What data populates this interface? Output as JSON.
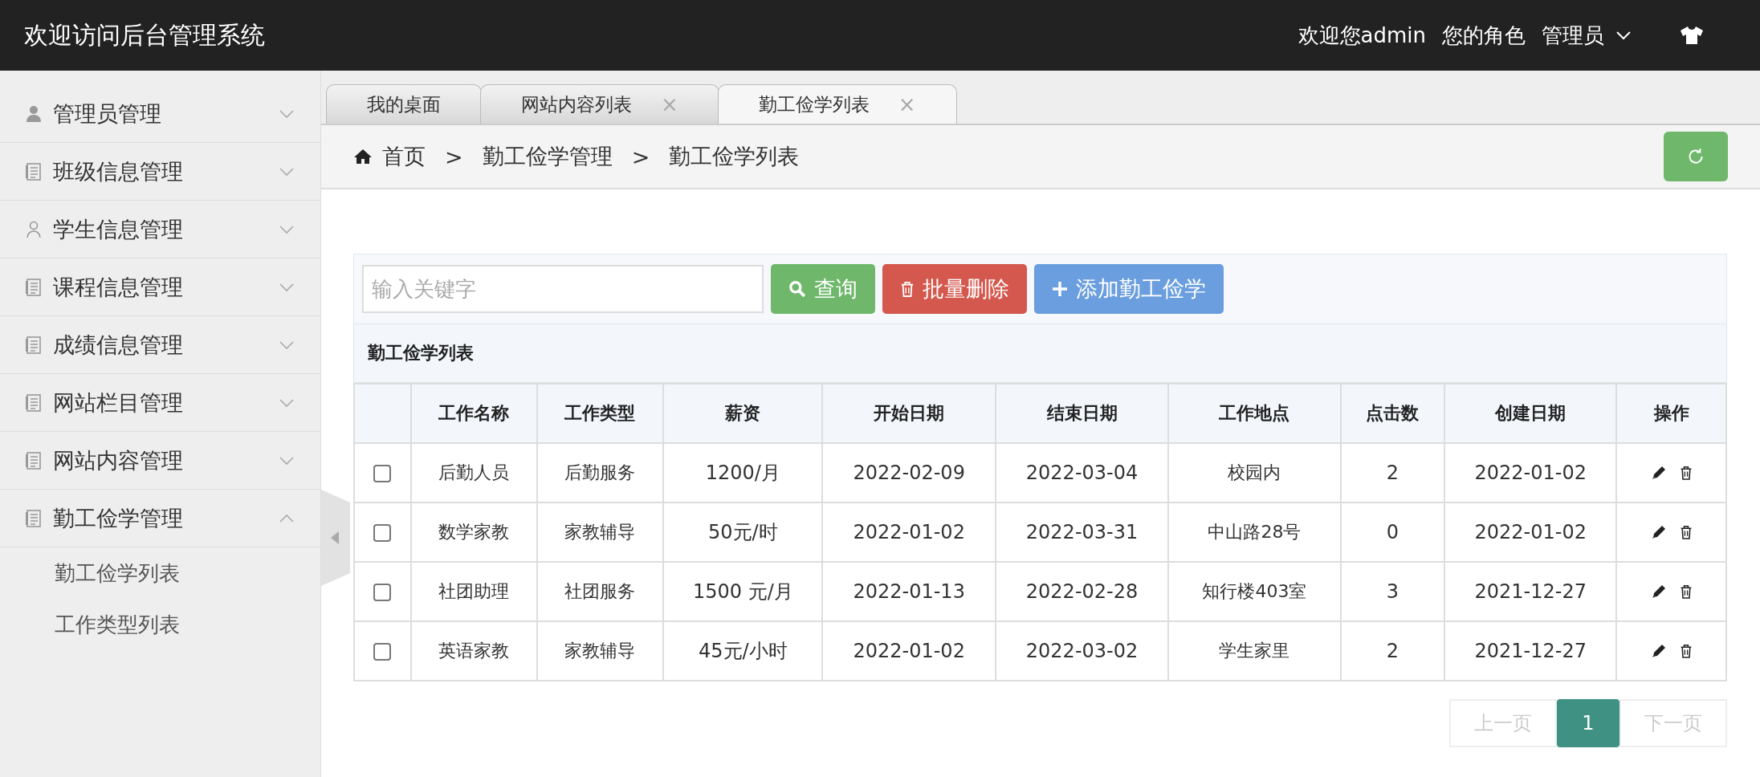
{
  "header": {
    "title": "欢迎访问后台管理系统",
    "welcome": "欢迎您admin",
    "role_label": "您的角色",
    "role": "管理员"
  },
  "sidebar": {
    "items": [
      {
        "label": "管理员管理",
        "expanded": false
      },
      {
        "label": "班级信息管理",
        "expanded": false
      },
      {
        "label": "学生信息管理",
        "expanded": false
      },
      {
        "label": "课程信息管理",
        "expanded": false
      },
      {
        "label": "成绩信息管理",
        "expanded": false
      },
      {
        "label": "网站栏目管理",
        "expanded": false
      },
      {
        "label": "网站内容管理",
        "expanded": false
      },
      {
        "label": "勤工俭学管理",
        "expanded": true,
        "children": [
          {
            "label": "勤工俭学列表"
          },
          {
            "label": "工作类型列表"
          }
        ]
      }
    ]
  },
  "tabs": [
    {
      "label": "我的桌面",
      "selected": false
    },
    {
      "label": "网站内容列表",
      "selected": false,
      "close": "×"
    },
    {
      "label": "勤工俭学列表",
      "selected": true,
      "close": "×"
    }
  ],
  "breadcrumb": [
    "首页",
    "勤工俭学管理",
    "勤工俭学列表"
  ],
  "breadcrumb_separator": ">",
  "toolbar": {
    "search": {
      "placeholder": "输入关键字"
    },
    "buttons": [
      {
        "kind": "search",
        "label": "查询"
      },
      {
        "kind": "delete",
        "label": "批量删除"
      },
      {
        "kind": "add",
        "label": "添加勤工俭学"
      }
    ]
  },
  "table": {
    "title": "勤工俭学列表",
    "columns": [
      "工作名称",
      "工作类型",
      "薪资",
      "开始日期",
      "结束日期",
      "工作地点",
      "点击数",
      "创建日期",
      "操作"
    ],
    "rows": [
      {
        "checked": false,
        "cells": [
          "后勤人员",
          "后勤服务",
          "1200/月",
          "2022-02-09",
          "2022-03-04",
          "校园内",
          "2",
          "2022-01-02"
        ]
      },
      {
        "checked": false,
        "cells": [
          "数学家教",
          "家教辅导",
          "50元/时",
          "2022-01-02",
          "2022-03-31",
          "中山路28号",
          "0",
          "2022-01-02"
        ]
      },
      {
        "checked": false,
        "cells": [
          "社团助理",
          "社团服务",
          "1500 元/月",
          "2022-01-13",
          "2022-02-28",
          "知行楼403室",
          "3",
          "2021-12-27"
        ]
      },
      {
        "checked": false,
        "cells": [
          "英语家教",
          "家教辅导",
          "45元/小时",
          "2022-01-02",
          "2022-03-02",
          "学生家里",
          "2",
          "2021-12-27"
        ]
      }
    ]
  },
  "pagination": [
    {
      "label": "上一页",
      "disabled": true,
      "selected": false
    },
    {
      "label": "1",
      "disabled": false,
      "selected": true
    },
    {
      "label": "下一页",
      "disabled": true,
      "selected": false
    }
  ]
}
